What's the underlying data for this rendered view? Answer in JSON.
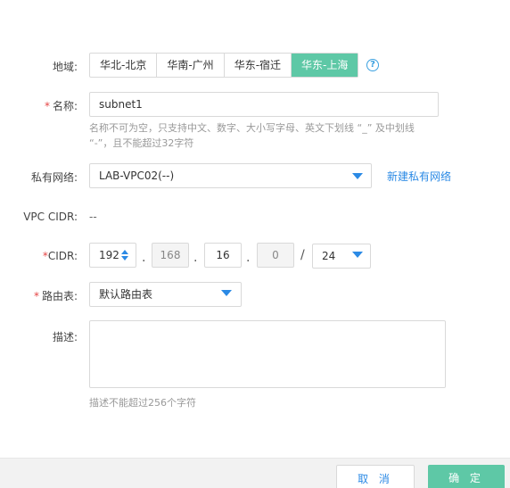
{
  "region": {
    "label": "地域:",
    "tabs": [
      "华北-北京",
      "华南-广州",
      "华东-宿迁",
      "华东-上海"
    ],
    "active_index": 3,
    "help_icon": "question-circle-icon"
  },
  "name": {
    "required_mark": "*",
    "label": "名称:",
    "value": "subnet1",
    "hint_line1": "名称不可为空，只支持中文、数字、大小写字母、英文下划线 “_” 及中划线",
    "hint_line2": "“-”，且不能超过32字符"
  },
  "vpc": {
    "label": "私有网络:",
    "selected": "LAB-VPC02(--)",
    "create_link": "新建私有网络"
  },
  "vpc_cidr": {
    "label": "VPC CIDR:",
    "value": "--"
  },
  "cidr": {
    "required_mark": "*",
    "label": "CIDR:",
    "octet1": "192",
    "octet2": "168",
    "octet3": "16",
    "octet4": "0",
    "separator": ".",
    "slash": "/",
    "mask": "24"
  },
  "route_table": {
    "required_mark": "*",
    "label": "路由表:",
    "selected": "默认路由表"
  },
  "description": {
    "label": "描述:",
    "value": "",
    "hint": "描述不能超过256个字符"
  },
  "footer": {
    "cancel_label": "取 消",
    "ok_label": "确 定"
  },
  "colors": {
    "accent_green": "#5ec8a6",
    "link_blue": "#2b8ae5",
    "required_red": "#e54545"
  }
}
